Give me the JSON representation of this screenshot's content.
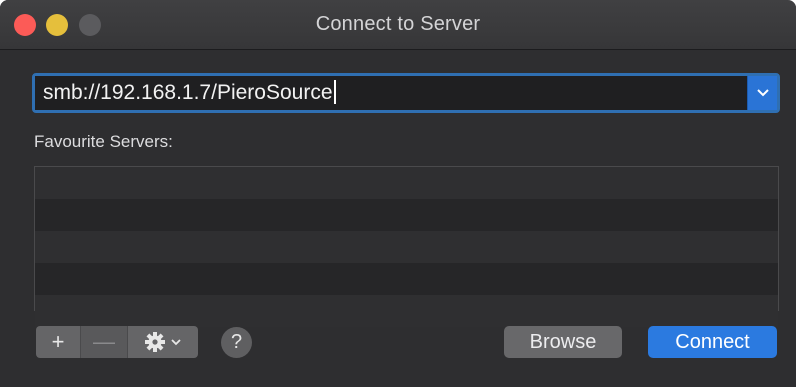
{
  "window": {
    "title": "Connect to Server"
  },
  "address": {
    "value": "smb://192.168.1.7/PieroSource",
    "dropdown_icon": "chevron-down-icon"
  },
  "favourites": {
    "label": "Favourite Servers:",
    "items": []
  },
  "toolbar": {
    "add_symbol": "+",
    "remove_symbol": "—",
    "help_symbol": "?",
    "browse_label": "Browse",
    "connect_label": "Connect"
  },
  "colors": {
    "accent": "#2b7ae0",
    "close": "#fc5b57",
    "minimize": "#e5bf3c",
    "zoom_disabled": "#5b5b5e"
  }
}
